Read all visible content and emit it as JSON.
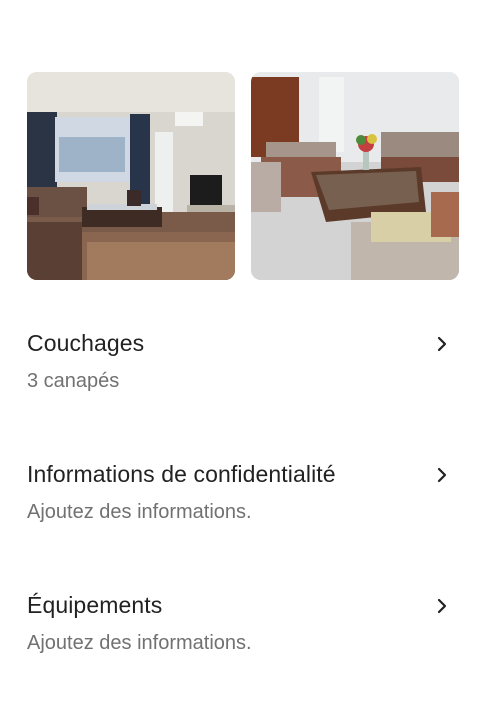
{
  "header": {
    "partial_text": "· · · · · ·"
  },
  "photos": [
    {
      "alt": "photo-living-room-1"
    },
    {
      "alt": "photo-living-room-2"
    }
  ],
  "rows": [
    {
      "title": "Couchages",
      "subtitle": "3 canapés"
    },
    {
      "title": "Informations de confidentialité",
      "subtitle": "Ajoutez des informations."
    },
    {
      "title": "Équipements",
      "subtitle": "Ajoutez des informations."
    }
  ],
  "icons": {
    "chevron": "chevron-right-icon"
  },
  "colors": {
    "text_primary": "#222222",
    "text_secondary": "#717171"
  }
}
